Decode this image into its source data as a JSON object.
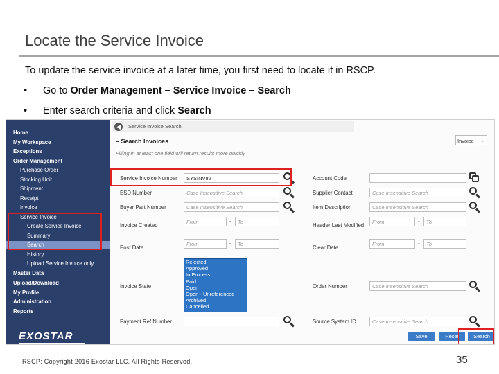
{
  "slide": {
    "title": "Locate the Service Invoice",
    "intro": "To update the service invoice at a later time, you first need to locate it in RSCP.",
    "bullet1_prefix": "Go to ",
    "bullet1_bold": "Order Management – Service Invoice – Search",
    "bullet2_prefix": "Enter search criteria and click ",
    "bullet2_bold": "Search",
    "bullet_glyph": "•",
    "footer": "RSCP: Copyright 2016 Exostar LLC. All Rights Reserved.",
    "page_number": "35"
  },
  "nav": {
    "home": "Home",
    "workspace": "My Workspace",
    "exceptions": "Exceptions",
    "order_management": "Order Management",
    "purchase_order": "Purchase Order",
    "stocking_unit": "Stocking Unit",
    "shipment": "Shipment",
    "receipt": "Receipt",
    "invoice": "Invoice",
    "service_invoice": "Service Invoice",
    "create_service_invoice": "Create Service Invoice",
    "summary": "Summary",
    "search": "Search",
    "history": "History",
    "upload_service_invoice": "Upload Service Invoice only",
    "master_data": "Master Data",
    "upload_download": "Upload/Download",
    "my_profile": "My Profile",
    "administration": "Administration",
    "reports": "Reports",
    "logo": "EXOSTAR"
  },
  "main": {
    "breadcrumb": "Service Invoice Search",
    "section_title": "Search Invoices",
    "section_glyph": "–",
    "hint": "Filling in at least one field will return results more quickly",
    "type_select": "Invoice",
    "labels": {
      "service_invoice_number": "Service Invoice Number",
      "esd_number": "ESD Number",
      "buyer_part_number": "Buyer Part Number",
      "invoice_created": "Invoice Created",
      "post_date": "Post Date",
      "invoice_state": "Invoice State",
      "payment_ref_number": "Payment Ref Number",
      "account_code": "Account Code",
      "supplier_contact": "Supplier Contact",
      "item_description": "Item Description",
      "header_last_modified": "Header Last Modified",
      "clear_date": "Clear Date",
      "order_number": "Order Number",
      "source_system_id": "Source System ID"
    },
    "values": {
      "service_invoice_number": "SYSINV82"
    },
    "placeholders": {
      "case_insensitive": "Case Insensitive Search",
      "from": "From",
      "to": "To"
    },
    "dash": "-",
    "invoice_states": [
      "Rejected",
      "Approved",
      "In Process",
      "Paid",
      "Open",
      "Open - Unreferenced",
      "Archived",
      "Cancelled"
    ],
    "buttons": {
      "save": "Save",
      "reset": "Reset",
      "search": "Search"
    }
  },
  "colors": {
    "nav_bg": "#2b3f6b",
    "nav_highlight": "#7b93c4",
    "button_blue": "#3b7bc8",
    "callout_red": "#e02020"
  }
}
